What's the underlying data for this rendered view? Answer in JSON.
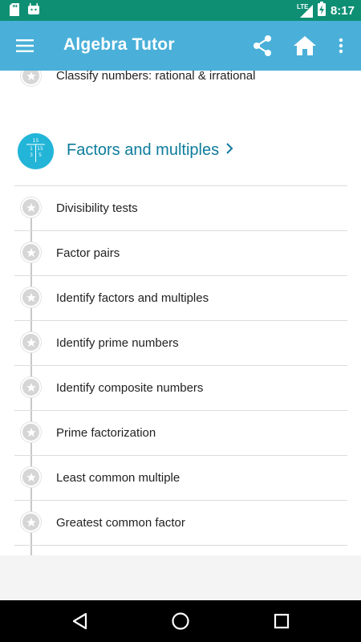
{
  "status_bar": {
    "time": "8:17",
    "network": "LTE",
    "left_icons": [
      "sd-card-icon",
      "android-icon"
    ],
    "right_icons": [
      "signal-icon",
      "battery-charging-icon"
    ]
  },
  "app_bar": {
    "title": "Algebra Tutor",
    "icons": [
      "menu-icon",
      "share-icon",
      "home-icon",
      "more-vert-icon"
    ]
  },
  "previous_item": {
    "label": "Classify numbers: rational & irrational"
  },
  "section": {
    "title": "Factors and multiples",
    "icon_numbers": [
      "15",
      "1",
      "15",
      "3",
      "5"
    ],
    "items": [
      {
        "label": "Divisibility tests"
      },
      {
        "label": "Factor pairs"
      },
      {
        "label": "Identify factors and multiples"
      },
      {
        "label": "Identify prime numbers"
      },
      {
        "label": "Identify composite numbers"
      },
      {
        "label": "Prime factorization"
      },
      {
        "label": "Least common multiple"
      },
      {
        "label": "Greatest common factor"
      }
    ]
  },
  "nav_bar": {
    "buttons": [
      "back-icon",
      "home-circle-icon",
      "recents-icon"
    ]
  },
  "colors": {
    "status_bar": "#0e8f74",
    "app_bar": "#4ab0d9",
    "section_title": "#0d7c9c",
    "section_icon": "#22b5d8",
    "star_badge": "#d6d6d6"
  }
}
